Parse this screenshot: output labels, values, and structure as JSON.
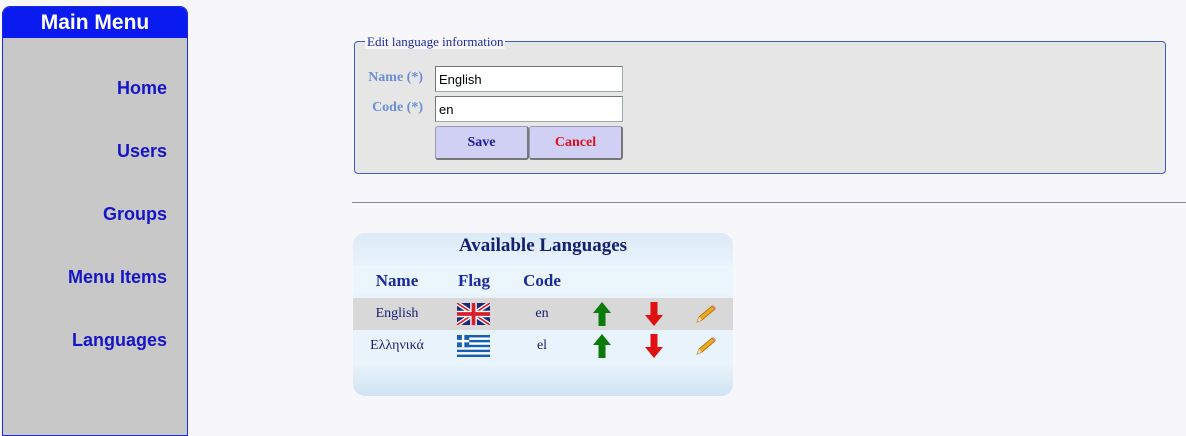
{
  "sidebar": {
    "title": "Main Menu",
    "items": [
      {
        "label": "Home"
      },
      {
        "label": "Users"
      },
      {
        "label": "Groups"
      },
      {
        "label": "Menu Items"
      },
      {
        "label": "Languages"
      }
    ]
  },
  "form": {
    "legend": "Edit language information",
    "name_label": "Name (*)",
    "name_value": "English",
    "code_label": "Code (*)",
    "code_value": "en",
    "save_label": "Save",
    "cancel_label": "Cancel",
    "cancel_color": "#e0101e"
  },
  "languages": {
    "title": "Available Languages",
    "headers": {
      "name": "Name",
      "flag": "Flag",
      "code": "Code"
    },
    "rows": [
      {
        "name": "English",
        "flag": "uk-flag",
        "code": "en"
      },
      {
        "name": "Ελληνικά",
        "flag": "greece-flag",
        "code": "el"
      }
    ],
    "row_colors": [
      "#d8d8d8",
      "#e9f3fb"
    ],
    "up_color": "#0a7a0a",
    "down_color": "#e01010"
  }
}
